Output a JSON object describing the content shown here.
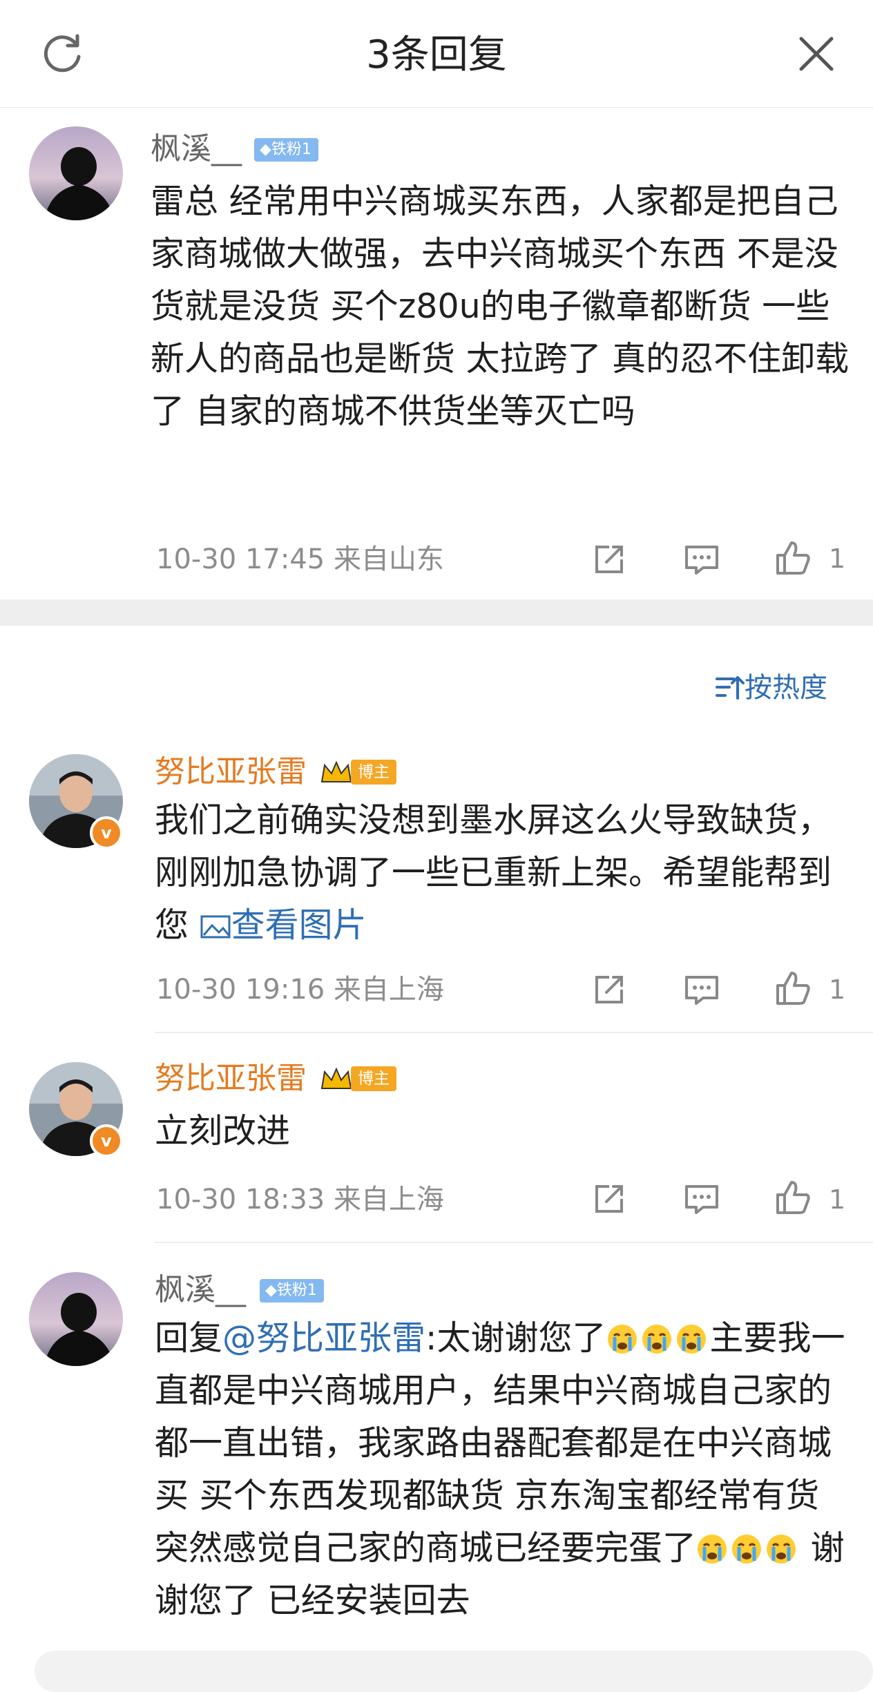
{
  "header": {
    "title": "3条回复"
  },
  "root_comment": {
    "username": "枫溪__",
    "badge": "铁粉1",
    "text": "雷总 经常用中兴商城买东西，人家都是把自己家商城做大做强，去中兴商城买个东西 不是没货就是没货 买个z80u的电子徽章都断货 一些新人的商品也是断货 太拉跨了 真的忍不住卸载了 自家的商城不供货坐等灭亡吗",
    "time": "10-30 17:45",
    "location": "来自山东",
    "likes": "1"
  },
  "sort": {
    "label": "按热度"
  },
  "replies": [
    {
      "username": "努比亚张雷",
      "badge": "博主",
      "text": "我们之前确实没想到墨水屏这么火导致缺货，刚刚加急协调了一些已重新上架。希望能帮到您 ",
      "link": "查看图片",
      "time": "10-30 19:16",
      "location": "来自上海",
      "likes": "1"
    },
    {
      "username": "努比亚张雷",
      "badge": "博主",
      "text": "立刻改进",
      "time": "10-30 18:33",
      "location": "来自上海",
      "likes": "1"
    },
    {
      "username": "枫溪__",
      "badge": "铁粉1",
      "reply_prefix": "回复",
      "mention": "@努比亚张雷",
      "text_a": ":太谢谢您了",
      "text_b": "主要我一直都是中兴商城用户，结果中兴商城自己家的都一直出错，我家路由器配套都是在中兴商城买 买个东西发现都缺货 京东淘宝都经常有货 突然感觉自己家的商城已经要完蛋了",
      "text_c": " 谢谢您了 已经安装回去"
    }
  ],
  "colors": {
    "link": "#2f6eb5",
    "blogger_name": "#e57a1f",
    "fan_badge": "#84b8f0",
    "blog_badge": "#f5a623"
  }
}
